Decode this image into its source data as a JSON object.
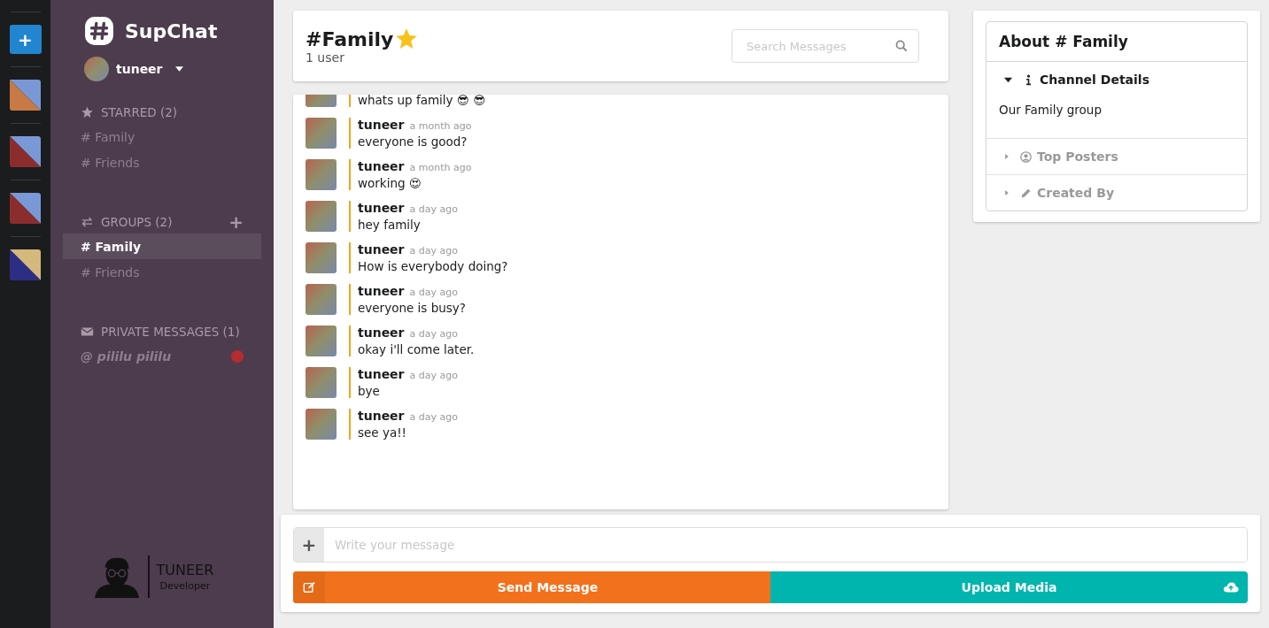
{
  "teams": [
    {
      "kind": "add",
      "label": "+"
    },
    {
      "kind": "team",
      "halves": [
        {
          "color": "#c77a45"
        },
        {
          "color": "#7b98d6"
        }
      ]
    },
    {
      "kind": "team",
      "halves": [
        {
          "color": "#8c2d2d"
        },
        {
          "color": "#7b98d6"
        }
      ]
    },
    {
      "kind": "team",
      "halves": [
        {
          "color": "#8c2d2d"
        },
        {
          "color": "#7b98d6"
        }
      ]
    },
    {
      "kind": "team",
      "halves": [
        {
          "color": "#2c2e86"
        },
        {
          "color": "#d5b87c"
        }
      ]
    }
  ],
  "app_name": "SupChat",
  "user": {
    "name": "tuneer"
  },
  "sections": [
    {
      "kind": "starred",
      "title": "STARRED (2)",
      "items": [
        {
          "label": "# Family",
          "selected": false
        },
        {
          "label": "# Friends",
          "selected": false
        }
      ]
    },
    {
      "kind": "groups",
      "title": "GROUPS (2)",
      "add": "+",
      "items": [
        {
          "label": "# Family",
          "selected": true
        },
        {
          "label": "# Friends",
          "selected": false
        }
      ]
    },
    {
      "kind": "private",
      "title": "PRIVATE MESSAGES (1)",
      "items": [
        {
          "label": "@ pililu pililu",
          "selected": false,
          "unread": true
        }
      ]
    }
  ],
  "signature": {
    "name": "TUNEER",
    "role": "Developer"
  },
  "channel": {
    "title": "#Family",
    "starred": true,
    "subtitle": "1 user"
  },
  "search": {
    "placeholder": "Search Messages"
  },
  "messages": [
    {
      "text": "whats up family 😎 😎"
    },
    {
      "author": "tuneer",
      "time": "a month ago",
      "text": "everyone is good?"
    },
    {
      "author": "tuneer",
      "time": "a month ago",
      "text": "working 😍"
    },
    {
      "author": "tuneer",
      "time": "a day ago",
      "text": "hey family"
    },
    {
      "author": "tuneer",
      "time": "a day ago",
      "text": "How is everybody doing?"
    },
    {
      "author": "tuneer",
      "time": "a day ago",
      "text": "everyone is busy?"
    },
    {
      "author": "tuneer",
      "time": "a day ago",
      "text": "okay i'll come later."
    },
    {
      "author": "tuneer",
      "time": "a day ago",
      "text": "bye"
    },
    {
      "author": "tuneer",
      "time": "a day ago",
      "text": "see ya!!"
    }
  ],
  "composer": {
    "add": "+",
    "placeholder": "Write your message",
    "send": "Send Message",
    "upload": "Upload Media"
  },
  "about": {
    "title": "About # Family",
    "sections": [
      {
        "kind": "info",
        "title": "Channel Details",
        "expanded": true,
        "body": "Our Family group"
      },
      {
        "kind": "posters",
        "title": "Top Posters",
        "expanded": false
      },
      {
        "kind": "creator",
        "title": "Created By",
        "expanded": false
      }
    ]
  }
}
